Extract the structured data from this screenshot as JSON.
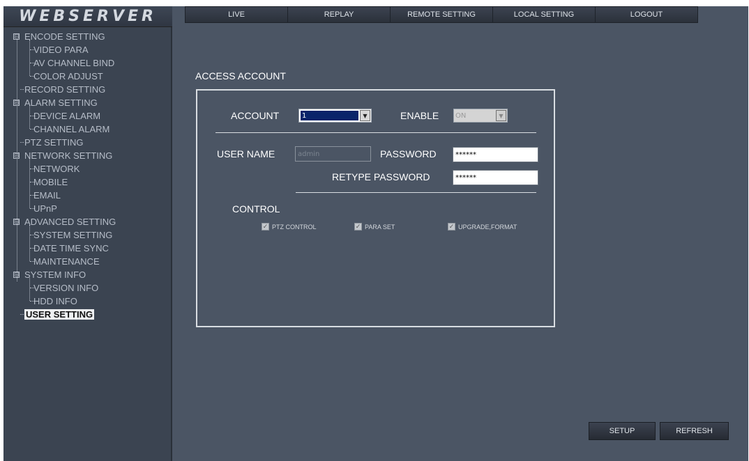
{
  "app": {
    "logo": "WEBSERVER"
  },
  "nav": {
    "items": [
      "LIVE",
      "REPLAY",
      "REMOTE SETTING",
      "LOCAL SETTING",
      "LOGOUT"
    ]
  },
  "sidebar": {
    "expand_glyph": "⊟",
    "items": [
      "ENCODE SETTING",
      "VIDEO PARA",
      "AV CHANNEL BIND",
      "COLOR ADJUST",
      "RECORD SETTING",
      "ALARM SETTING",
      "DEVICE ALARM",
      "CHANNEL ALARM",
      "PTZ SETTING",
      "NETWORK SETTING",
      "NETWORK",
      "MOBILE",
      "EMAIL",
      "UPnP",
      "ADVANCED SETTING",
      "SYSTEM SETTING",
      "DATE TIME SYNC",
      "MAINTENANCE",
      "SYSTEM INFO",
      "VERSION INFO",
      "HDD INFO",
      "USER SETTING"
    ],
    "selected": "USER SETTING"
  },
  "main": {
    "section_title": "ACCESS ACCOUNT",
    "account": {
      "label": "ACCOUNT",
      "value": "1"
    },
    "enable": {
      "label": "ENABLE",
      "value": "ON"
    },
    "username": {
      "label": "USER NAME",
      "value": "admin"
    },
    "password": {
      "label": "PASSWORD",
      "value": "******"
    },
    "retype_password": {
      "label": "RETYPE PASSWORD",
      "value": "******"
    },
    "control": {
      "label": "CONTROL",
      "options": [
        {
          "label": "PTZ CONTROL",
          "checked": true
        },
        {
          "label": "PARA SET",
          "checked": true
        },
        {
          "label": "UPGRADE,FORMAT",
          "checked": true
        }
      ]
    },
    "buttons": {
      "setup": "SETUP",
      "refresh": "REFRESH"
    }
  },
  "colors": {
    "background": "#4b5564",
    "sidebar": "#3b4451",
    "selected_bg": "#eef0f2",
    "accent_select": "#0a246a"
  }
}
